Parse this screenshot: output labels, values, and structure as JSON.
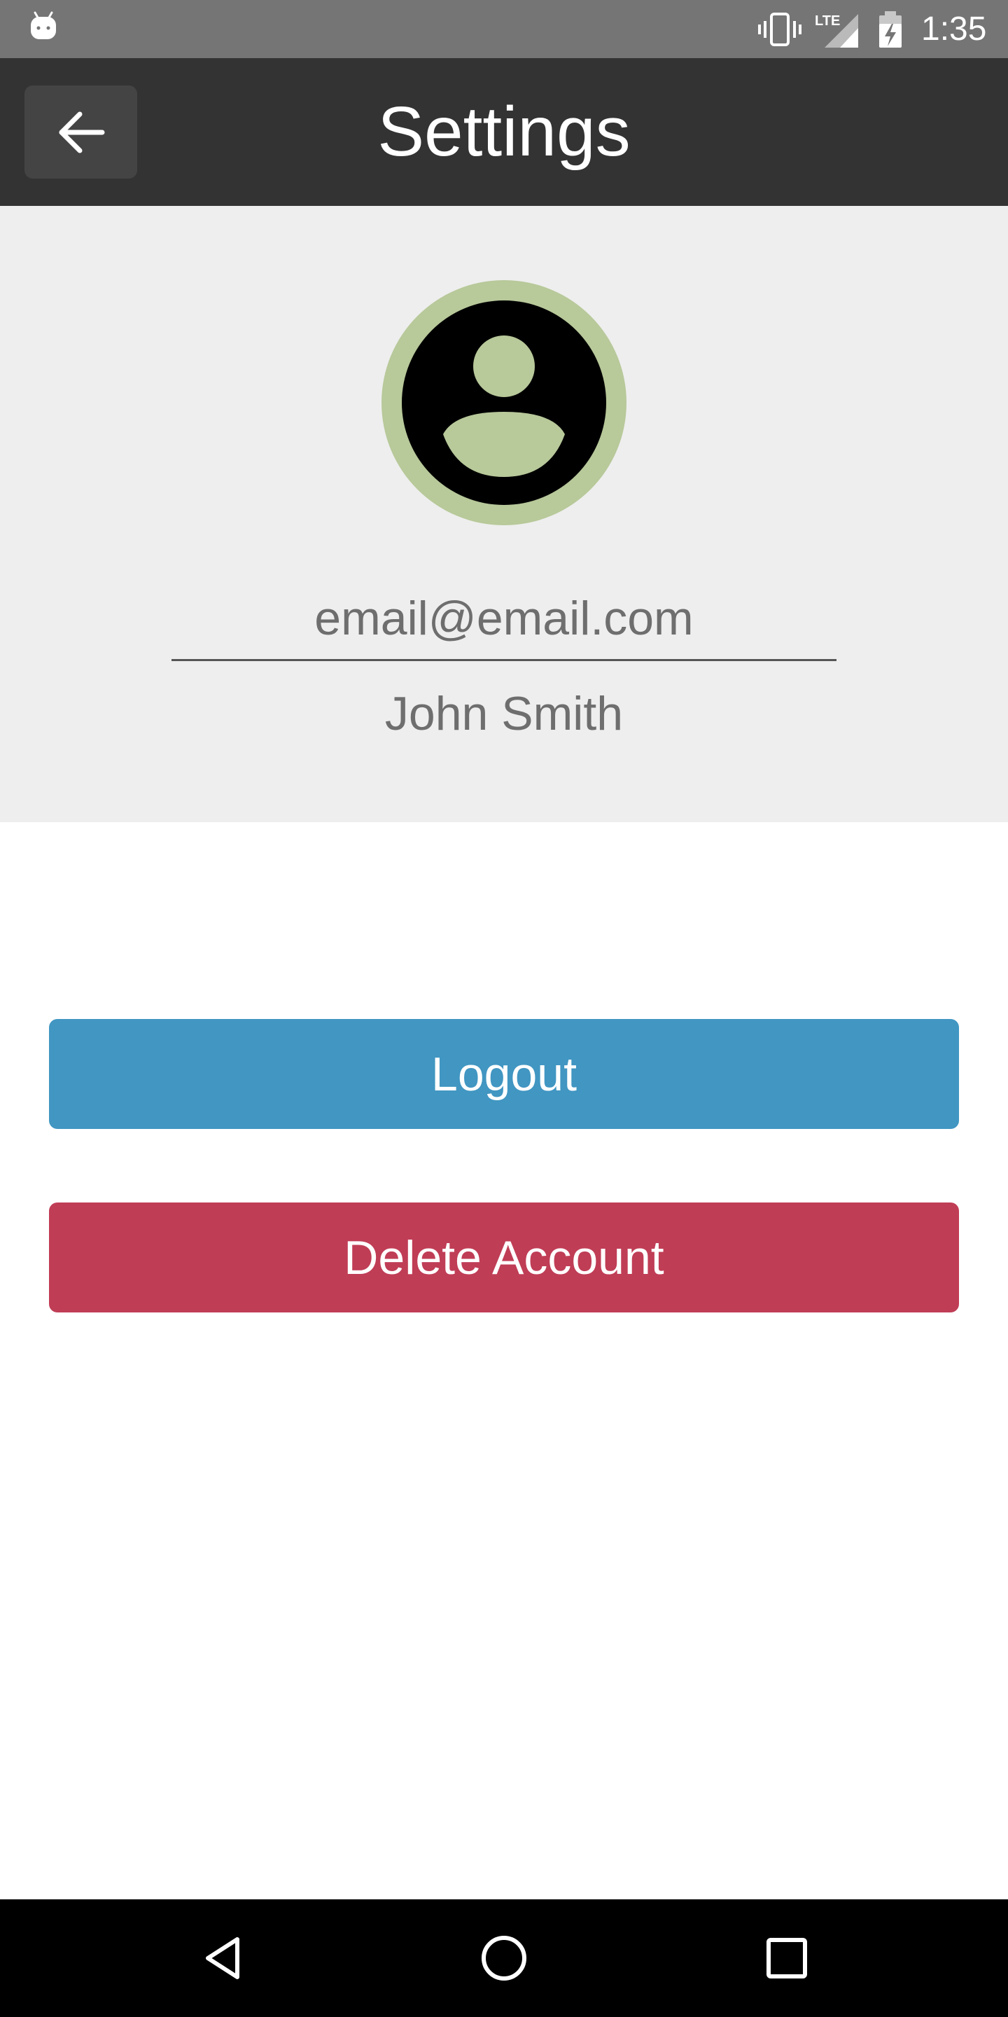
{
  "status_bar": {
    "time": "1:35",
    "network_label": "LTE",
    "icons": [
      "android-icon",
      "vibrate-icon",
      "signal-icon",
      "battery-charging-icon"
    ]
  },
  "toolbar": {
    "title": "Settings",
    "back_icon": "arrow-left-icon"
  },
  "profile": {
    "avatar_icon": "account-circle-icon",
    "email": "email@email.com",
    "name": "John Smith"
  },
  "actions": {
    "logout_label": "Logout",
    "delete_label": "Delete Account"
  },
  "nav_bar": {
    "icons": [
      "nav-back-icon",
      "nav-home-icon",
      "nav-recents-icon"
    ]
  },
  "colors": {
    "status_bar": "#757575",
    "toolbar": "#333333",
    "profile_panel": "#eeeeee",
    "avatar_accent": "#b8c99a",
    "logout": "#4196c2",
    "delete": "#c03d56"
  }
}
